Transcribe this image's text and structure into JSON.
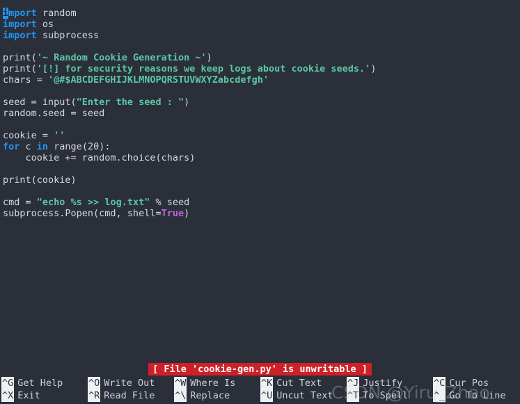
{
  "editor": {
    "app": "nano",
    "filename": "cookie-gen.py",
    "background_color": "#2b2f3a",
    "cursor": {
      "line": 1,
      "column": 1,
      "char": "i"
    },
    "colors": {
      "keyword": "#2196f3",
      "string": "#5ac8a0",
      "constant": "#c463d6",
      "plain": "#d5d8de",
      "status_bg": "#cf2027",
      "status_fg": "#ffffff",
      "key_badge_bg": "#eef0f2",
      "key_badge_fg": "#2b2f3a"
    },
    "lines": [
      {
        "n": 1,
        "text": "import random"
      },
      {
        "n": 2,
        "text": "import os"
      },
      {
        "n": 3,
        "text": "import subprocess"
      },
      {
        "n": 4,
        "text": ""
      },
      {
        "n": 5,
        "text": "print('~ Random Cookie Generation ~')"
      },
      {
        "n": 6,
        "text": "print('[!] for security reasons we keep logs about cookie seeds.')"
      },
      {
        "n": 7,
        "text": "chars = '@#$ABCDEFGHIJKLMNOPQRSTUVWXYZabcdefgh'"
      },
      {
        "n": 8,
        "text": ""
      },
      {
        "n": 9,
        "text": "seed = input(\"Enter the seed : \")"
      },
      {
        "n": 10,
        "text": "random.seed = seed"
      },
      {
        "n": 11,
        "text": ""
      },
      {
        "n": 12,
        "text": "cookie = ''"
      },
      {
        "n": 13,
        "text": "for c in range(20):"
      },
      {
        "n": 14,
        "text": "    cookie += random.choice(chars)"
      },
      {
        "n": 15,
        "text": ""
      },
      {
        "n": 16,
        "text": "print(cookie)"
      },
      {
        "n": 17,
        "text": ""
      },
      {
        "n": 18,
        "text": "cmd = \"echo %s >> log.txt\" % seed"
      },
      {
        "n": 19,
        "text": "subprocess.Popen(cmd, shell=True)"
      }
    ]
  },
  "status": {
    "message": "[ File 'cookie-gen.py' is unwritable ]"
  },
  "shortcuts": {
    "row0": [
      {
        "key": "^G",
        "label": "Get Help"
      },
      {
        "key": "^O",
        "label": "Write Out"
      },
      {
        "key": "^W",
        "label": "Where Is"
      },
      {
        "key": "^K",
        "label": "Cut Text"
      },
      {
        "key": "^J",
        "label": "Justify"
      },
      {
        "key": "^C",
        "label": "Cur Pos"
      }
    ],
    "row1": [
      {
        "key": "^X",
        "label": "Exit"
      },
      {
        "key": "^R",
        "label": "Read File"
      },
      {
        "key": "^\\",
        "label": "Replace"
      },
      {
        "key": "^U",
        "label": "Uncut Text"
      },
      {
        "key": "^T",
        "label": "To Spell"
      },
      {
        "key": "^_",
        "label": "Go To Line"
      }
    ]
  },
  "watermark": {
    "brand": "CSDN",
    "user": "@Yiru_Zhao"
  }
}
